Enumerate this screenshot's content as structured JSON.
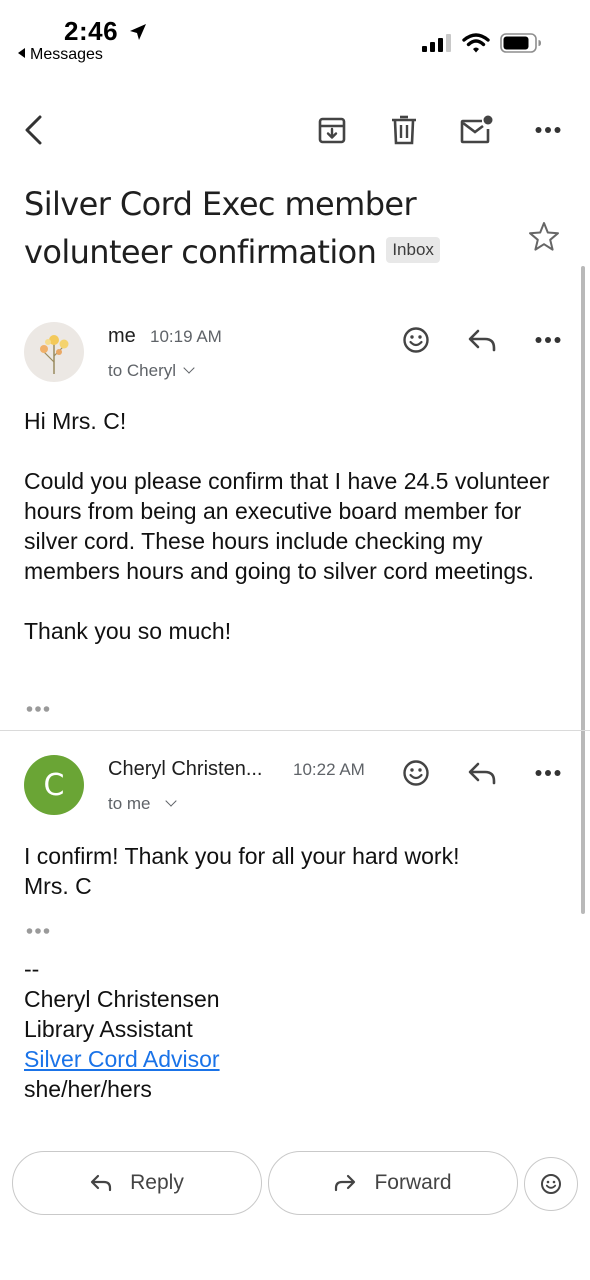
{
  "status_bar": {
    "time": "2:46",
    "back_app": "Messages"
  },
  "toolbar": {
    "icons": [
      "back-arrow-icon",
      "archive-icon",
      "trash-icon",
      "mark-unread-icon",
      "more-icon"
    ]
  },
  "subject": {
    "title": "Silver Cord Exec member volunteer confirmation",
    "label": "Inbox"
  },
  "messages": [
    {
      "sender": "me",
      "time": "10:19 AM",
      "recipient": "to Cheryl",
      "body": "Hi Mrs. C!\n\nCould you please confirm that I have 24.5 volunteer hours from being an executive board member for silver cord. These hours include checking my members hours and going to silver cord meetings.\n\nThank you so much!"
    },
    {
      "sender": "Cheryl Christen...",
      "avatar_letter": "C",
      "time": "10:22 AM",
      "recipient": "to me",
      "body": "I confirm!  Thank you for all your hard work!\nMrs. C",
      "signature": {
        "separator": "--",
        "name": "Cheryl Christensen",
        "role": "Library Assistant",
        "link": "Silver Cord Advisor",
        "pronouns": "she/her/hers"
      }
    }
  ],
  "actions": {
    "reply": "Reply",
    "forward": "Forward"
  },
  "colors": {
    "avatar_c": "#6aa535",
    "link": "#1a73e8",
    "label_bg": "#e8e8e8"
  }
}
